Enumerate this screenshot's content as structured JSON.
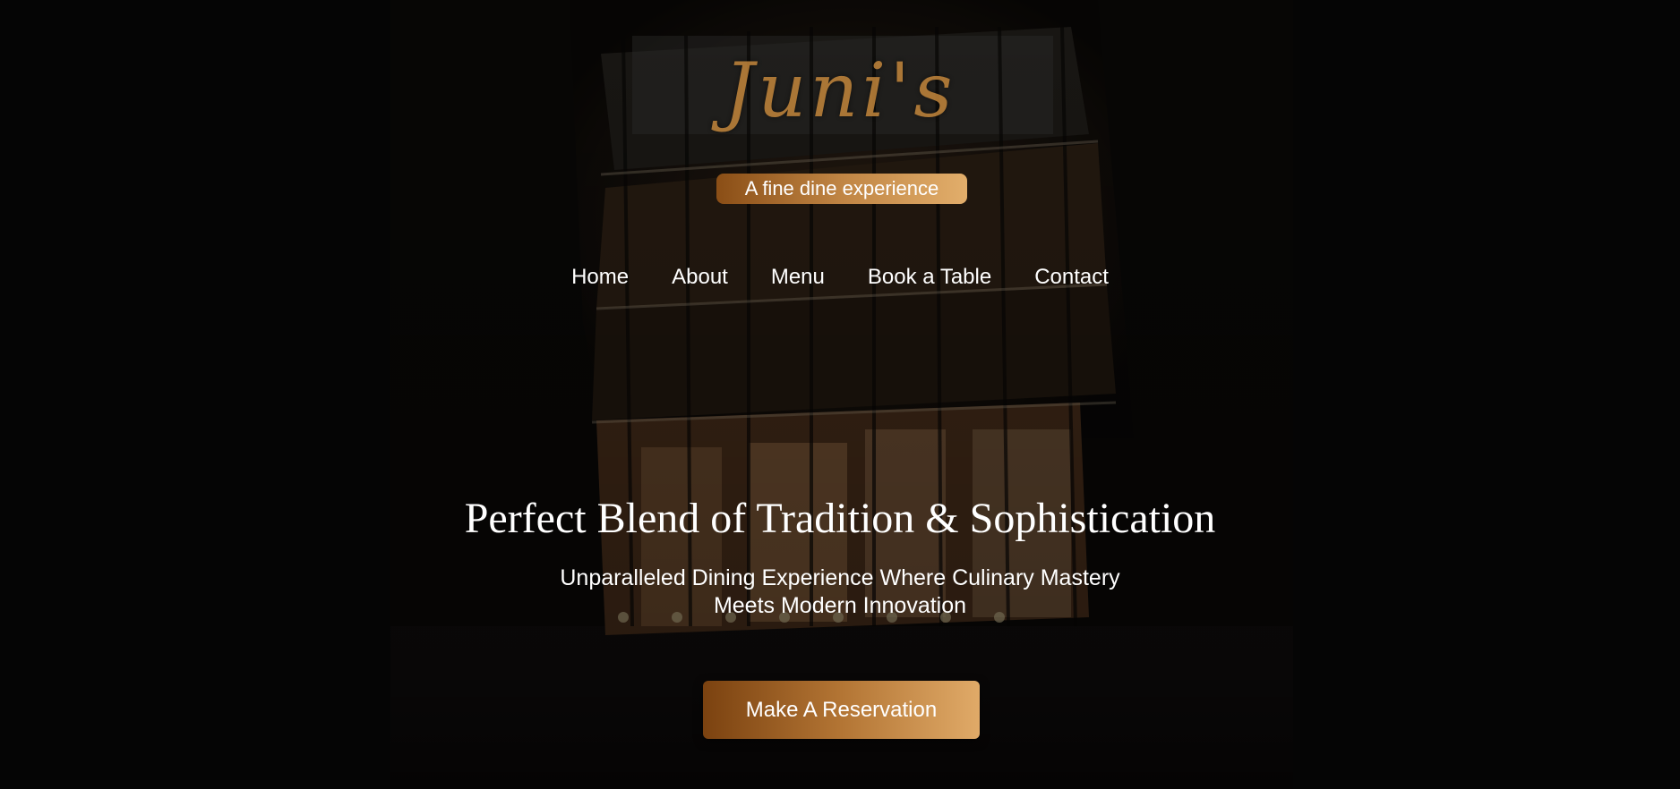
{
  "brand": {
    "logo_text": "Juni's",
    "tagline": "A fine dine experience",
    "accent_color": "#c98a3c"
  },
  "nav": {
    "items": [
      {
        "label": "Home"
      },
      {
        "label": "About"
      },
      {
        "label": "Menu"
      },
      {
        "label": "Book a Table"
      },
      {
        "label": "Contact"
      }
    ]
  },
  "hero": {
    "headline": "Perfect Blend of Tradition & Sophistication",
    "subline_1": "Unparalleled Dining Experience Where Culinary Mastery",
    "subline_2": "Meets Modern Innovation",
    "cta_label": "Make A Reservation",
    "background_image": "restaurant-building-night"
  }
}
